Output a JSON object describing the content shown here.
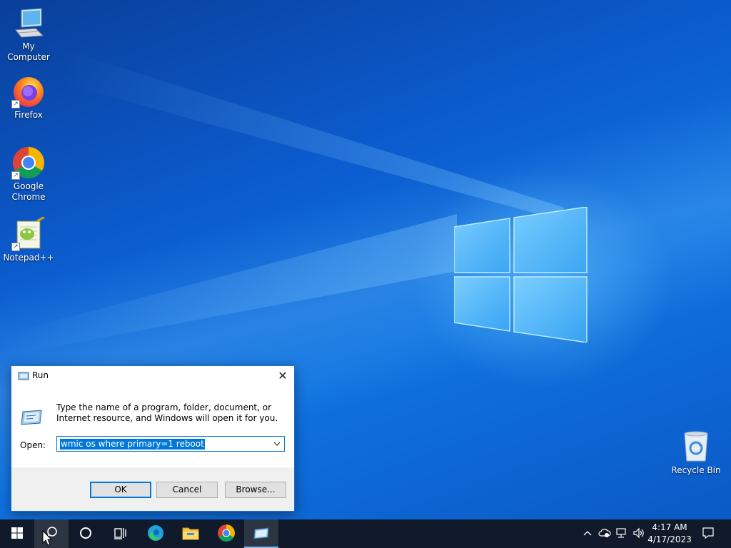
{
  "desktop": {
    "icons": [
      {
        "label": "My Computer",
        "icon": "monitor-icon"
      },
      {
        "label": "Firefox",
        "icon": "firefox-icon"
      },
      {
        "label": "Google Chrome",
        "icon": "chrome-icon"
      },
      {
        "label": "Notepad++",
        "icon": "notepadpp-icon"
      },
      {
        "label": "Recycle Bin",
        "icon": "recycle-bin-icon"
      }
    ]
  },
  "run_dialog": {
    "title": "Run",
    "close_glyph": "✕",
    "description": "Type the name of a program, folder, document, or Internet resource, and Windows will open it for you.",
    "open_label": "Open:",
    "open_value": "wmic os where primary=1 reboot",
    "ok_label": "OK",
    "cancel_label": "Cancel",
    "browse_label": "Browse..."
  },
  "taskbar": {
    "items": [
      "start-icon",
      "search-icon",
      "cortana-icon",
      "task-view-icon",
      "edge-icon",
      "file-explorer-icon",
      "chrome-icon",
      "run-icon"
    ],
    "tray": [
      "chevron-up-icon",
      "onedrive-icon",
      "network-icon",
      "volume-icon"
    ],
    "time": "4:17 AM",
    "date": "4/17/2023",
    "notifications_icon": "notification-icon"
  },
  "colors": {
    "accent": "#0078d7",
    "taskbar": "#101a2a",
    "wallpaper": "#0b5ccf"
  }
}
